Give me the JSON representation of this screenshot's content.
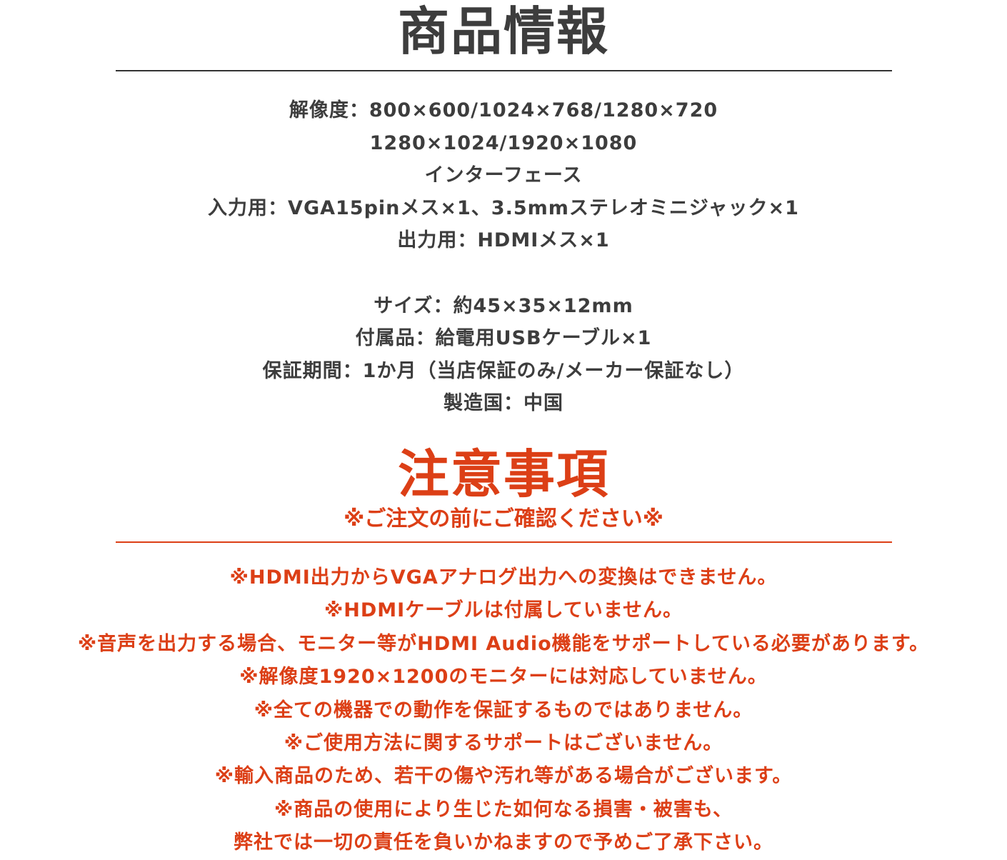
{
  "product_info": {
    "title": "商品情報",
    "lines": [
      "解像度：800×600/1024×768/1280×720",
      "1280×1024/1920×1080",
      "インターフェース",
      "入力用：VGA15pinメス×1、3.5mmステレオミニジャック×1",
      "出力用：HDMIメス×1",
      "",
      "サイズ：約45×35×12mm",
      "付属品：給電用USBケーブル×1",
      "保証期間：1か月（当店保証のみ/メーカー保証なし）",
      "製造国：中国"
    ]
  },
  "cautions": {
    "title": "注意事項",
    "subtitle": "※ご注文の前にご確認ください※",
    "lines": [
      "※HDMI出力からVGAアナログ出力への変換はできません。",
      "※HDMIケーブルは付属していません。",
      "※音声を出力する場合、モニター等がHDMI Audio機能をサポートしている必要があります。",
      "※解像度1920×1200のモニターには対応していません。",
      "※全ての機器での動作を保証するものではありません。",
      "※ご使用方法に関するサポートはございません。",
      "※輸入商品のため、若干の傷や汚れ等がある場合がございます。",
      "※商品の使用により生じた如何なる損害・被害も、",
      "弊社では一切の責任を負いかねますので予めご了承下さい。"
    ]
  },
  "colors": {
    "text_dark": "#3d3d3d",
    "accent_red": "#dc3f16"
  }
}
